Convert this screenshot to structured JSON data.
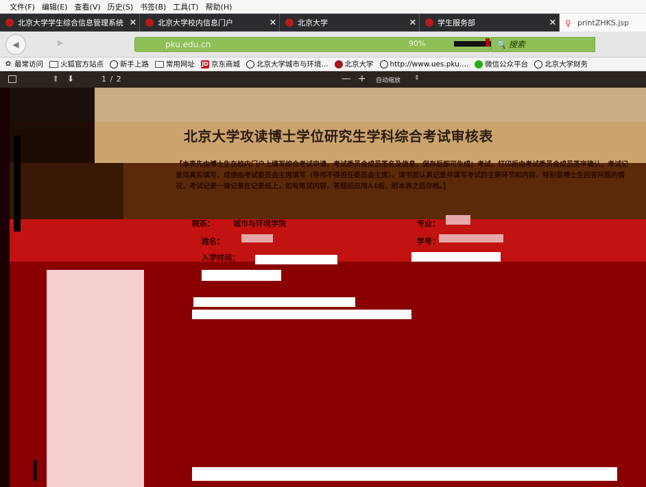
{
  "menubar": {
    "items": [
      "文件(F)",
      "编辑(E)",
      "查看(V)",
      "历史(S)",
      "书签(B)",
      "工具(T)",
      "帮助(H)"
    ]
  },
  "tabs": [
    {
      "title": "北京大学学生综合信息管理系统",
      "icon": "pku-favicon"
    },
    {
      "title": "北京大学校内信息门户",
      "icon": "pku-favicon"
    },
    {
      "title": "北京大学",
      "icon": "pku-favicon"
    },
    {
      "title": "学生服务部",
      "icon": "pku-favicon"
    },
    {
      "title": "printZHKS.jsp",
      "icon": "pdf-favicon",
      "active": true
    }
  ],
  "navbar": {
    "url": "pku.edu.cn",
    "zoom": "90%",
    "search_placeholder": "搜索"
  },
  "bookmarks": [
    {
      "label": "最常访问",
      "icon": "gear-icon"
    },
    {
      "label": "火狐官方站点",
      "icon": "folder-icon"
    },
    {
      "label": "新手上路",
      "icon": "globe-icon"
    },
    {
      "label": "常用网址",
      "icon": "folder-icon"
    },
    {
      "label": "京东商城",
      "icon": "jd-icon"
    },
    {
      "label": "北京大学城市与环境...",
      "icon": "globe-icon"
    },
    {
      "label": "北京大学",
      "icon": "pku-icon"
    },
    {
      "label": "http://www.ues.pku....",
      "icon": "globe-icon"
    },
    {
      "label": "微信公众平台",
      "icon": "wechat-icon"
    },
    {
      "label": "北京大学财务",
      "icon": "globe-icon"
    }
  ],
  "pdf_toolbar": {
    "page_indicator": "1 / 2",
    "zoom_label": "自动缩放"
  },
  "document": {
    "title": "北京大学攻读博士学位研究生学科综合考试审核表",
    "note": "【本表先由博士生在校内门户上填写综合考试申请，考试委员会成员签名及信息，保存后即可生成；考试、打印后由考试委员会成员签字确认，考试记录须真实填写，成绩由考试委员会主席填写（导师不得担任委员会主席）。请书面认真记录并填写考试的主要环节和内容，特别是博士生回答问题的情况，考试记录一律记录在记录纸上，如有笔试内容，答题纸应用A4纸，附本表之后存档。】",
    "fields": {
      "dept_label": "院系：",
      "dept_value": "城市与环境学院",
      "major_label": "专业：",
      "name_label": "姓名：",
      "id_label": "学号：",
      "enroll_label": "入学时间："
    }
  },
  "colors": {
    "tab_bg": "#2b2c30",
    "url_green": "#8fbf57",
    "doc_red": "#b50000",
    "doc_maroon": "#8a0000"
  }
}
